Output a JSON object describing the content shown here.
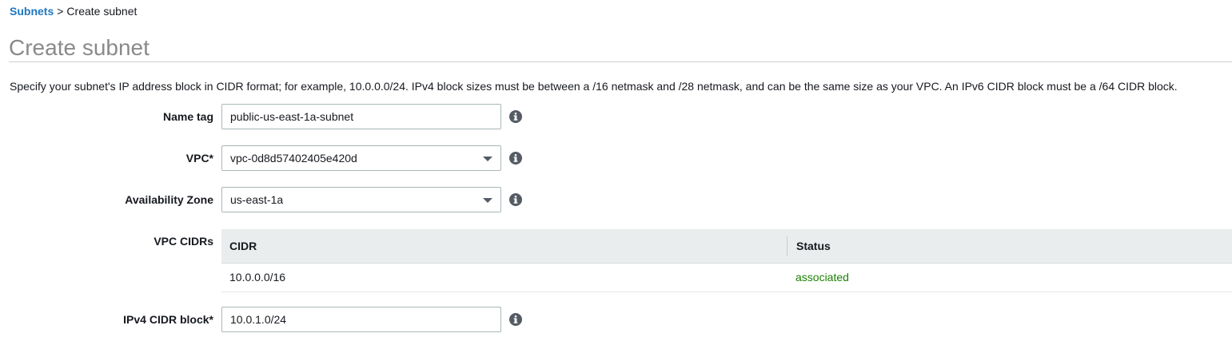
{
  "breadcrumb": {
    "link": "Subnets",
    "separator": ">",
    "current": "Create subnet"
  },
  "page": {
    "title": "Create subnet",
    "description": "Specify your subnet's IP address block in CIDR format; for example, 10.0.0.0/24. IPv4 block sizes must be between a /16 netmask and /28 netmask, and can be the same size as your VPC. An IPv6 CIDR block must be a /64 CIDR block."
  },
  "form": {
    "name_tag": {
      "label": "Name tag",
      "value": "public-us-east-1a-subnet",
      "info_icon": "info-icon"
    },
    "vpc": {
      "label": "VPC*",
      "value": "vpc-0d8d57402405e420d",
      "info_icon": "info-icon"
    },
    "availability_zone": {
      "label": "Availability Zone",
      "value": "us-east-1a",
      "info_icon": "info-icon"
    },
    "vpc_cidrs": {
      "label": "VPC CIDRs",
      "columns": [
        "CIDR",
        "Status"
      ],
      "rows": [
        {
          "cidr": "10.0.0.0/16",
          "status": "associated"
        }
      ]
    },
    "ipv4_cidr": {
      "label": "IPv4 CIDR block*",
      "value": "10.0.1.0/24",
      "info_icon": "info-icon"
    }
  },
  "colors": {
    "link": "#1f77c0",
    "status_ok": "#1d8102",
    "table_header_bg": "#eaeded",
    "title_gray": "#8a8a8a"
  }
}
